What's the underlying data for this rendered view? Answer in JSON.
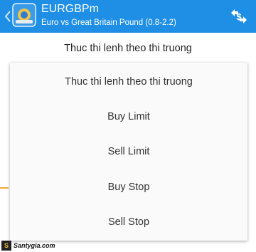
{
  "header": {
    "title": "EURGBPm",
    "subtitle": "Euro vs Great Britain Pound (0.8-2.2)",
    "back_icon": "chevron-left-icon",
    "app_icon": "forex-app-icon",
    "action_icon": "currency-exchange-icon",
    "bg_color": "#1f8fe6"
  },
  "spinner": {
    "selected": "Thuc thi lenh theo thi truong"
  },
  "dropdown": {
    "items": [
      {
        "label": "Thuc thi lenh theo thi truong"
      },
      {
        "label": "Buy Limit"
      },
      {
        "label": "Sell Limit"
      },
      {
        "label": "Buy Stop"
      },
      {
        "label": "Sell Stop"
      }
    ]
  },
  "watermark": {
    "logo": "S",
    "text": "Santygia.com"
  }
}
